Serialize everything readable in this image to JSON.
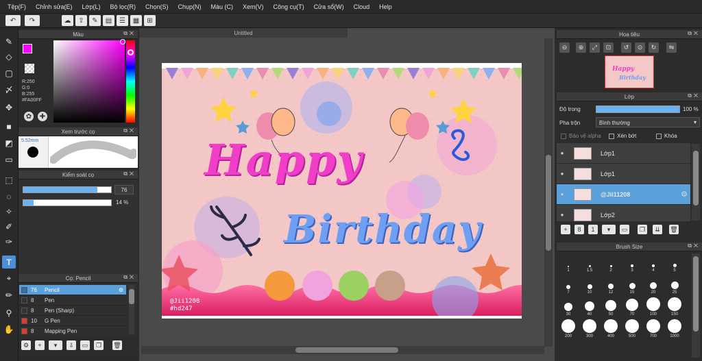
{
  "menu": [
    "Tệp(F)",
    "Chỉnh sửa(E)",
    "Lớp(L)",
    "Bộ lọc(R)",
    "Chọn(S)",
    "Chụp(N)",
    "Màu (C)",
    "Xem(V)",
    "Công cụ(T)",
    "Cửa sổ(W)",
    "Cloud",
    "Help"
  ],
  "color_panel": {
    "title": "Màu",
    "r": "R:250",
    "g": "G:0",
    "b": "B:255",
    "hex": "#FA00FF",
    "primary": "#FA00FF",
    "secondary": "#6f8dea"
  },
  "brush_preview": {
    "title": "Xem trước cọ",
    "size": "5.52mm"
  },
  "brush_control": {
    "title": "Kiểm soát cọ",
    "size_value": "76",
    "size_fraction": 0.84,
    "opacity_value": "14 %",
    "opacity_fraction": 0.12
  },
  "brush_list": {
    "title": "Cọ: Pencil",
    "items": [
      {
        "num": "76",
        "name": "Pencil",
        "color": "#3a6ea8"
      },
      {
        "num": "8",
        "name": "Pen",
        "color": "#333333"
      },
      {
        "num": "8",
        "name": "Pen (Sharp)",
        "color": "#333333"
      },
      {
        "num": "10",
        "name": "G Pen",
        "color": "#e53935"
      },
      {
        "num": "8",
        "name": "Mapping Pen",
        "color": "#e53935"
      }
    ]
  },
  "document": {
    "title": "Untitled"
  },
  "artwork": {
    "line1": "Happy",
    "line2": "Birthday",
    "tag1": "@Jii1208",
    "tag2": "#hd247"
  },
  "navigator": {
    "title": "Hoa tiêu"
  },
  "layers": {
    "title": "Lớp",
    "opacity_label": "Độ trong",
    "opacity_value": "100 %",
    "opacity_fraction": 1.0,
    "blend_label": "Pha trộn",
    "blend_value": "Bình thường",
    "protect_alpha": "Bảo vệ alpha",
    "clipping": "Xén bớt",
    "lock": "Khóa",
    "items": [
      {
        "name": "Lớp1",
        "selected": false
      },
      {
        "name": "Lớp1",
        "selected": false
      },
      {
        "name": "@Jii11208",
        "selected": true
      },
      {
        "name": "Lớp2",
        "selected": false
      }
    ]
  },
  "brush_size": {
    "title": "Brush Size",
    "sizes": [
      "1",
      "1.5",
      "2",
      "3",
      "4",
      "5",
      "7",
      "10",
      "12",
      "15",
      "20",
      "25",
      "30",
      "40",
      "50",
      "70",
      "100",
      "150",
      "200",
      "300",
      "400",
      "500",
      "700",
      "1000"
    ]
  }
}
